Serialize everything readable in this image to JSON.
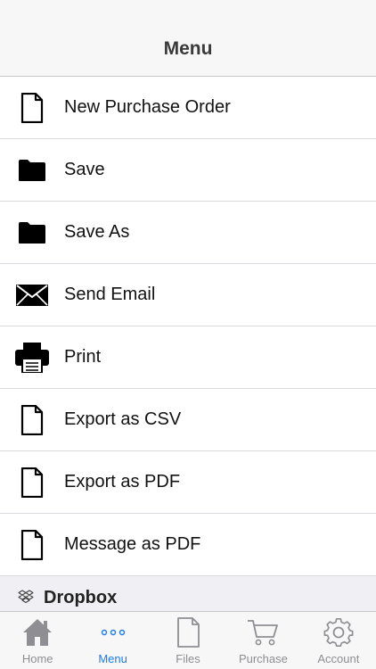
{
  "header": {
    "title": "Menu"
  },
  "menu": {
    "items": [
      {
        "label": "New Purchase Order",
        "icon": "document-icon"
      },
      {
        "label": "Save",
        "icon": "folder-icon"
      },
      {
        "label": "Save As",
        "icon": "folder-icon"
      },
      {
        "label": "Send Email",
        "icon": "envelope-icon"
      },
      {
        "label": "Print",
        "icon": "printer-icon"
      },
      {
        "label": "Export as CSV",
        "icon": "document-icon"
      },
      {
        "label": "Export as PDF",
        "icon": "document-icon"
      },
      {
        "label": "Message as PDF",
        "icon": "document-icon"
      }
    ]
  },
  "section": {
    "label": "Dropbox",
    "icon": "dropbox-icon"
  },
  "tabbar": {
    "tabs": [
      {
        "label": "Home",
        "icon": "home-icon",
        "active": false
      },
      {
        "label": "Menu",
        "icon": "more-dots-icon",
        "active": true
      },
      {
        "label": "Files",
        "icon": "file-icon",
        "active": false
      },
      {
        "label": "Purchase",
        "icon": "cart-icon",
        "active": false
      },
      {
        "label": "Account",
        "icon": "gear-icon",
        "active": false
      }
    ],
    "active_color": "#1a7cf5",
    "inactive_color": "#8e8e93"
  }
}
